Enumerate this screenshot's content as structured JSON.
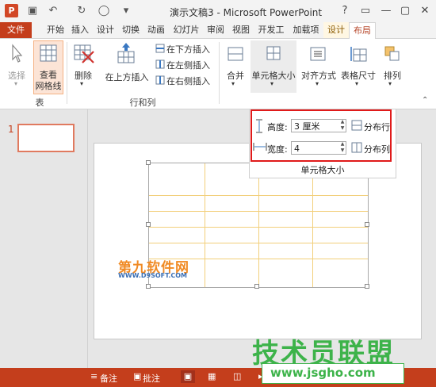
{
  "window": {
    "title": "演示文稿3 - Microsoft PowerPoint",
    "app_icon_text": "P",
    "buttons": [
      "?",
      "▭",
      "—",
      "▢",
      "✕"
    ]
  },
  "quick_access": [
    "save-icon",
    "undo-icon",
    "redo-icon",
    "present-icon",
    "customize-icon"
  ],
  "tabs": [
    {
      "label": "文件"
    },
    {
      "label": "开始"
    },
    {
      "label": "插入"
    },
    {
      "label": "设计"
    },
    {
      "label": "切换"
    },
    {
      "label": "动画"
    },
    {
      "label": "幻灯片"
    },
    {
      "label": "审阅"
    },
    {
      "label": "视图"
    },
    {
      "label": "开发工"
    },
    {
      "label": "加载项"
    },
    {
      "label": "设计"
    },
    {
      "label": "布局"
    }
  ],
  "ribbon": {
    "select_label": "选择",
    "view_gridlines_label1": "查看",
    "view_gridlines_label2": "网格线",
    "group_table": "表",
    "delete_label": "删除",
    "insert_above_label": "在上方插入",
    "insert_below_label": "在下方插入",
    "insert_left_label": "在左侧插入",
    "insert_right_label": "在右侧插入",
    "group_rows_cols": "行和列",
    "merge_label": "合并",
    "cell_size_label": "单元格大小",
    "alignment_label": "对齐方式",
    "table_size_label": "表格尺寸",
    "arrange_label": "排列"
  },
  "cell_size_panel": {
    "height_label": "高度:",
    "height_value": "3 厘米",
    "width_label": "宽度:",
    "width_value": "4",
    "distribute_rows": "分布行",
    "distribute_cols": "分布列",
    "group_label": "单元格大小"
  },
  "thumbnail": {
    "number": "1"
  },
  "statusbar": {
    "notes_label": "备注",
    "comments_label": "批注"
  },
  "watermarks": {
    "top_text": "第九软件网",
    "top_url": "WWW.D9SOFT.COM",
    "bottom_text": "技术员联盟",
    "bottom_url": "www.jsgho.com"
  }
}
